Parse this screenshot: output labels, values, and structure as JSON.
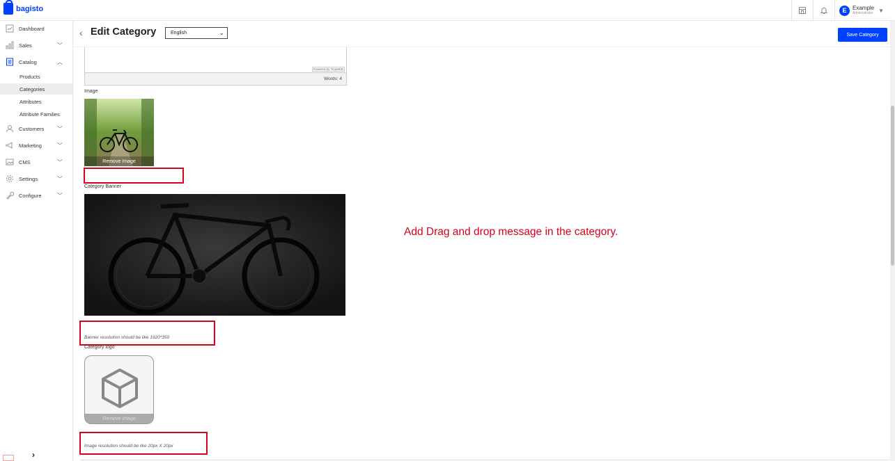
{
  "brand": {
    "name": "bagisto",
    "accent": "#0041ff"
  },
  "topbar": {
    "icons": [
      "storefront-icon",
      "bell-icon"
    ],
    "user": {
      "initial": "E",
      "name": "Example",
      "role": "Administrator"
    }
  },
  "sidebar": {
    "items": [
      {
        "label": "Dashboard",
        "icon": "dashboard-icon"
      },
      {
        "label": "Sales",
        "icon": "sales-icon"
      },
      {
        "label": "Catalog",
        "icon": "catalog-icon"
      },
      {
        "label": "Customers",
        "icon": "customers-icon"
      },
      {
        "label": "Marketing",
        "icon": "marketing-icon"
      },
      {
        "label": "CMS",
        "icon": "cms-icon"
      },
      {
        "label": "Settings",
        "icon": "settings-icon"
      },
      {
        "label": "Configure",
        "icon": "configure-icon"
      }
    ],
    "catalog_sub": [
      {
        "label": "Products"
      },
      {
        "label": "Categories",
        "active": true
      },
      {
        "label": "Attributes"
      },
      {
        "label": "Attribute Families"
      }
    ],
    "toggle": "›"
  },
  "header": {
    "title": "Edit Category",
    "locale_selected": "English",
    "save_label": "Save Category"
  },
  "editor": {
    "powered_by": "Powered by TinyMCE",
    "word_count": "Words: 4"
  },
  "form": {
    "image_label": "Image",
    "remove_image": "Remove Image",
    "banner_label": "Category Banner",
    "banner_hint": "Banner resolution should be like 1920*350",
    "logo_label": "Category logo",
    "logo_remove": "Remove Image",
    "logo_hint": "Image resolution should be like 20px X 20px"
  },
  "annotation": {
    "text": "Add Drag and drop message in the category.",
    "color": "#d8001a"
  }
}
